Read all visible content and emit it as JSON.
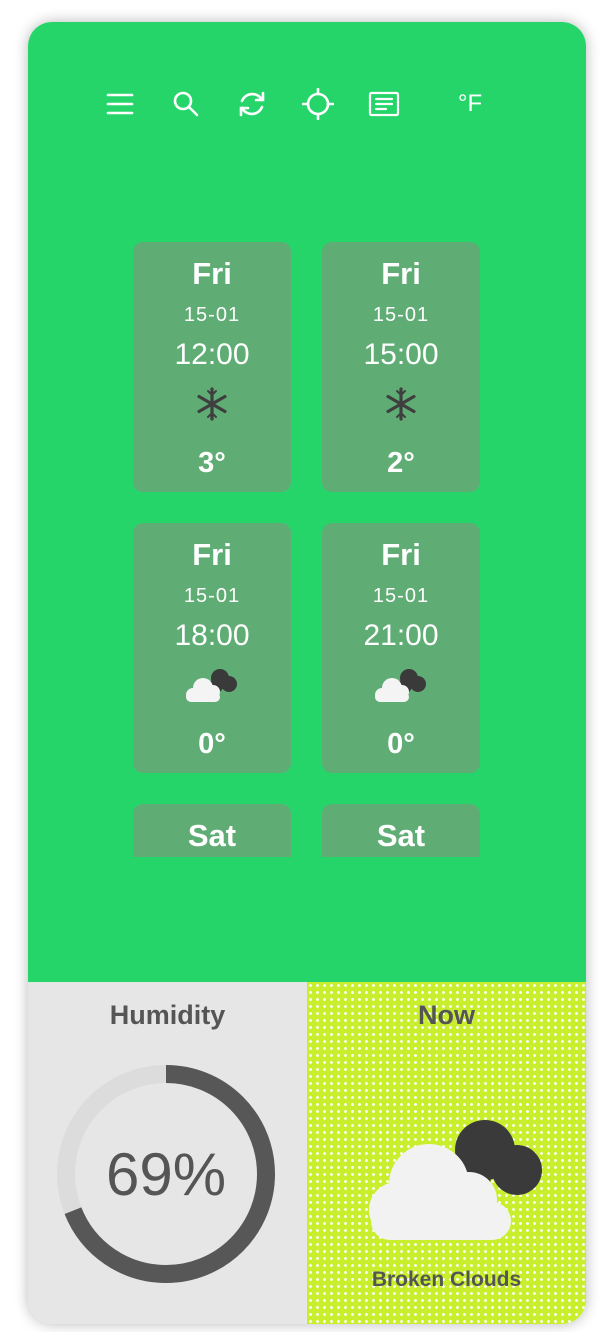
{
  "toolbar": {
    "icons": [
      "menu-icon",
      "search-icon",
      "refresh-icon",
      "locate-icon",
      "list-icon"
    ],
    "unit_label": "°F"
  },
  "forecast": [
    {
      "day": "Fri",
      "date": "15-01",
      "time": "12:00",
      "icon": "snow-icon",
      "temp": "3°"
    },
    {
      "day": "Fri",
      "date": "15-01",
      "time": "15:00",
      "icon": "snow-icon",
      "temp": "2°"
    },
    {
      "day": "Fri",
      "date": "15-01",
      "time": "18:00",
      "icon": "broken-clouds-icon",
      "temp": "0°"
    },
    {
      "day": "Fri",
      "date": "15-01",
      "time": "21:00",
      "icon": "broken-clouds-icon",
      "temp": "0°"
    },
    {
      "day": "Sat"
    },
    {
      "day": "Sat"
    }
  ],
  "humidity": {
    "title": "Humidity",
    "value_text": "69%",
    "value": 0.69
  },
  "now": {
    "title": "Now",
    "icon": "broken-clouds-icon",
    "description": "Broken Clouds"
  },
  "colors": {
    "primary": "#25d56a",
    "card": "#5fad74",
    "panel_gray": "#e6e6e6",
    "accent_lime": "#c9ee2e",
    "text_dark": "#555555"
  }
}
